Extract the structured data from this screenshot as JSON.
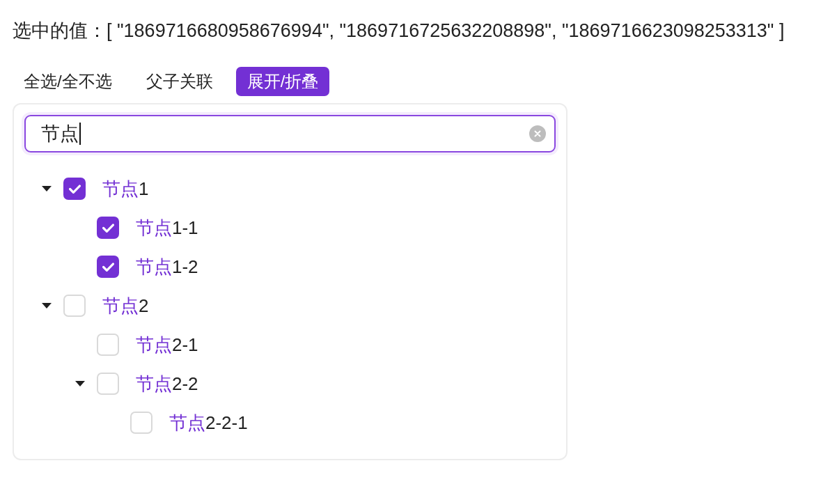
{
  "selected_values": "选中的值：[ \"1869716680958676994\", \"1869716725632208898\", \"1869716623098253313\" ]",
  "buttons": [
    {
      "label": "全选/全不选",
      "selected": false
    },
    {
      "label": "父子关联",
      "selected": false
    },
    {
      "label": "展开/折叠",
      "selected": true
    }
  ],
  "tree": {
    "search": {
      "value": "节点",
      "focused": true
    },
    "nodes": [
      {
        "label": [
          {
            "text": "节点",
            "highlighted": true
          },
          {
            "text": "1",
            "highlighted": false
          }
        ],
        "checked": true,
        "expanded": true,
        "children": [
          {
            "label": [
              {
                "text": "节点",
                "highlighted": true
              },
              {
                "text": "1-1",
                "highlighted": false
              }
            ],
            "checked": true
          },
          {
            "label": [
              {
                "text": "节点",
                "highlighted": true
              },
              {
                "text": "1-2",
                "highlighted": false
              }
            ],
            "checked": true
          }
        ]
      },
      {
        "label": [
          {
            "text": "节点",
            "highlighted": true
          },
          {
            "text": "2",
            "highlighted": false
          }
        ],
        "checked": false,
        "expanded": true,
        "children": [
          {
            "label": [
              {
                "text": "节点",
                "highlighted": true
              },
              {
                "text": "2-1",
                "highlighted": false
              }
            ],
            "checked": false
          },
          {
            "label": [
              {
                "text": "节点",
                "highlighted": true
              },
              {
                "text": "2-2",
                "highlighted": false
              }
            ],
            "checked": false,
            "expanded": true,
            "children": [
              {
                "label": [
                  {
                    "text": "节点",
                    "highlighted": true
                  },
                  {
                    "text": "2-2-1",
                    "highlighted": false
                  }
                ],
                "checked": false
              }
            ]
          }
        ]
      }
    ]
  }
}
